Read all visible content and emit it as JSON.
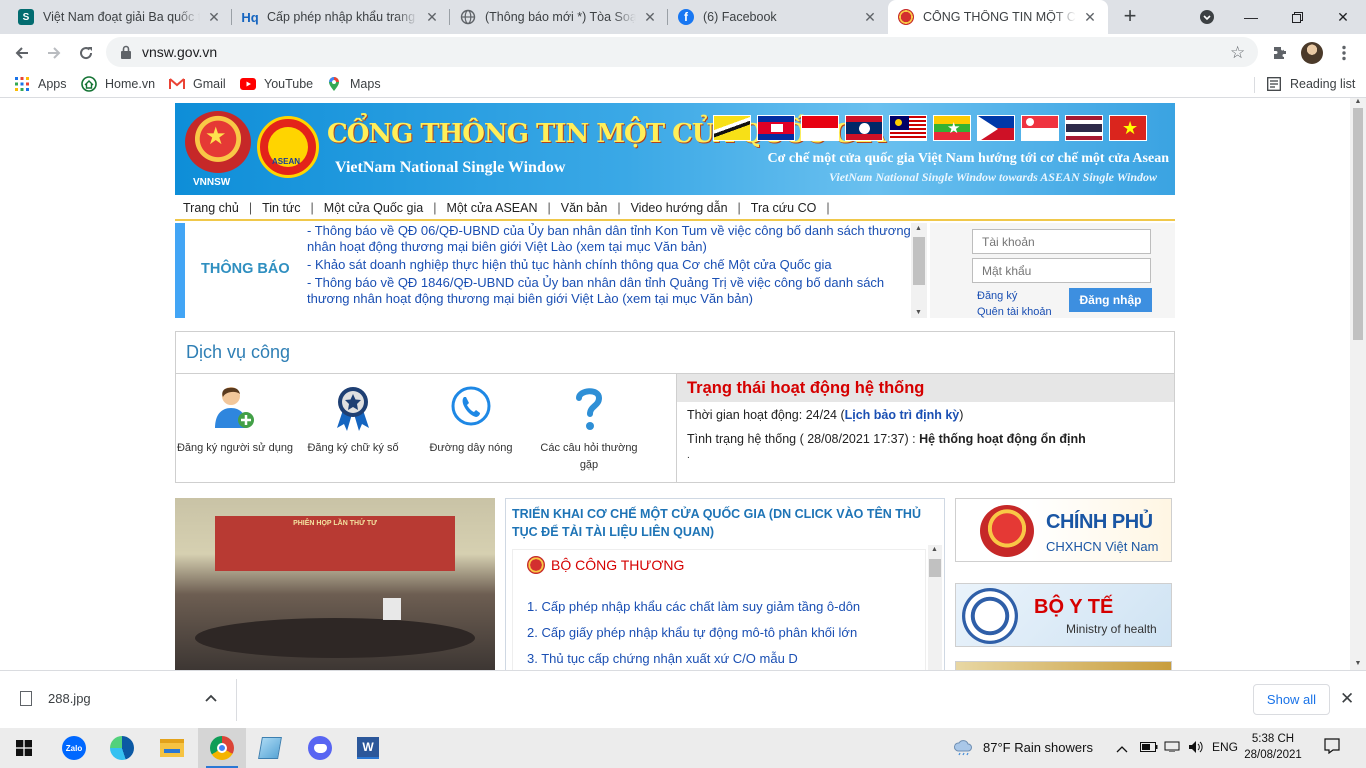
{
  "browser": {
    "tabs": [
      {
        "title": "Việt Nam đoạt giải Ba quốc tế",
        "favicon": "sharepoint-icon"
      },
      {
        "title": "Cấp phép nhập khẩu trang thiết",
        "favicon": "hq-icon"
      },
      {
        "title": "(Thông báo mới *) Tòa Soạn Báo",
        "favicon": "globe-icon"
      },
      {
        "title": "(6) Facebook",
        "favicon": "facebook-icon"
      },
      {
        "title": "CỔNG THÔNG TIN MỘT CỬA QUỐC",
        "favicon": "emblem-icon"
      }
    ],
    "url": "vnsw.gov.vn",
    "bookmarks": [
      "Apps",
      "Home.vn",
      "Gmail",
      "YouTube",
      "Maps"
    ],
    "reading_list": "Reading list"
  },
  "site": {
    "vnnsw": "VNNSW",
    "asean": "ASEAN",
    "title": "CỔNG THÔNG TIN MỘT CỬA QUỐC GIA",
    "subtitle": "VietNam National Single Window",
    "right_line1": "Cơ chế một cửa quốc gia Việt Nam hướng tới cơ chế một cửa Asean",
    "right_line2": "VietNam National Single Window towards ASEAN Single Window",
    "menu": [
      "Trang chủ",
      "Tin tức",
      "Một cửa Quốc gia",
      "Một cửa ASEAN",
      "Văn bản",
      "Video hướng dẫn",
      "Tra cứu CO"
    ],
    "notice_label": "THÔNG BÁO",
    "notices": [
      "- Thông báo về QĐ 06/QĐ-UBND của Ủy ban nhân dân tỉnh Kon Tum về việc công bố danh sách thương nhân hoạt động thương mại biên giới Việt Lào (xem tại mục Văn bản)",
      "- Khảo sát doanh nghiệp thực hiện thủ tục hành chính thông qua Cơ chế Một cửa Quốc gia",
      "- Thông báo về QĐ 1846/QĐ-UBND của Ủy ban nhân dân tỉnh Quảng Trị về việc công bố danh sách thương nhân hoạt động thương mại biên giới Việt Lào (xem tại mục Văn bản)"
    ],
    "login": {
      "account_placeholder": "Tài khoản",
      "password_placeholder": "Mật khẩu",
      "register": "Đăng ký",
      "forgot": "Quên tài khoản",
      "submit": "Đăng nhập"
    },
    "public_services": {
      "title": "Dịch vụ công",
      "items": [
        "Đăng ký người sử dụng",
        "Đăng ký chữ ký số",
        "Đường dây nóng",
        "Các câu hỏi thường gặp"
      ]
    },
    "status": {
      "title": "Trạng thái hoạt động hệ thống",
      "uptime_label": "Thời gian hoạt động: 24/24 (",
      "uptime_link": "Lịch bảo trì định kỳ",
      "uptime_close": ")",
      "state_label": "Tình trạng hệ thống ( 28/08/2021 17:37) : ",
      "state_value": "Hệ thống hoạt động ổn định",
      "dot": "."
    },
    "photo_banner": "PHIÊN HỌP LẦN THỨ TƯ",
    "procedures": {
      "header": "TRIỂN KHAI CƠ CHẾ MỘT CỬA QUỐC GIA (DN CLICK VÀO TÊN THỦ TỤC ĐỂ TẢI TÀI LIỆU LIÊN QUAN)",
      "ministry": "BỘ CÔNG THƯƠNG",
      "items": [
        "1. Cấp phép nhập khẩu các chất làm suy giảm tầng ô-dôn",
        "2. Cấp giấy phép nhập khẩu tự động mô-tô phân khối lớn",
        "3. Thủ tục cấp chứng nhận xuất xứ C/O mẫu D"
      ]
    },
    "sidebar": {
      "gov_title": "CHÍNH PHỦ",
      "gov_sub": "CHXHCN Việt Nam",
      "moh_title": "BỘ Y TẾ",
      "moh_sub": "Ministry of health"
    }
  },
  "download": {
    "file": "288.jpg",
    "show_all": "Show all"
  },
  "taskbar": {
    "zalo": "Zalo",
    "word": "W",
    "weather": "87°F  Rain showers",
    "lang": "ENG",
    "time": "5:38 CH",
    "date": "28/08/2021"
  }
}
